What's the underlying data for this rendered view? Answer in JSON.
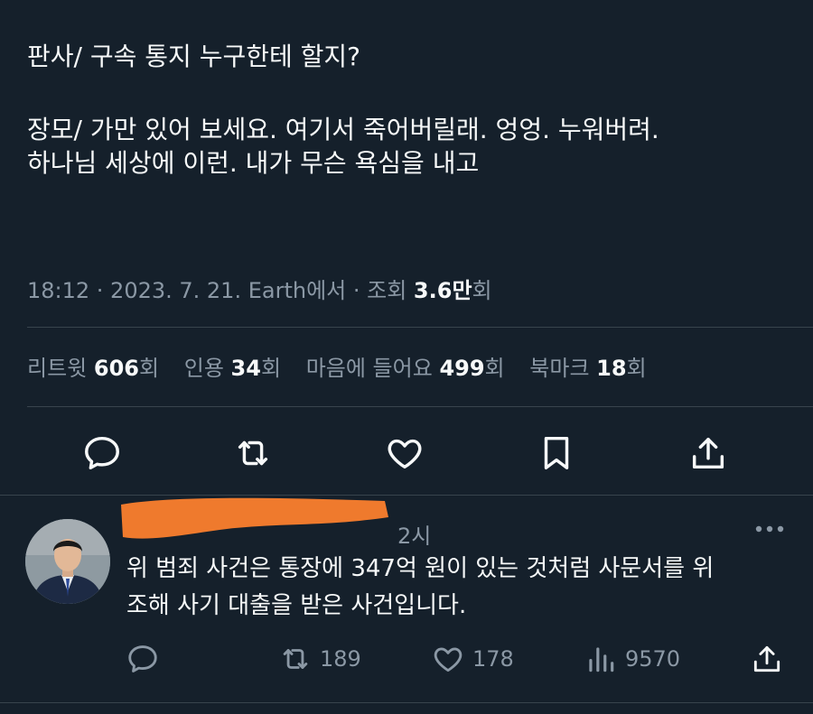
{
  "tweet": {
    "line1": "판사/ 구속 통지 누구한테 할지?",
    "line2": "장모/ 가만 있어 보세요. 여기서 죽어버릴래. 엉엉. 누워버려.",
    "line3": "하나님 세상에 이런. 내가 무슨 욕심을 내고",
    "time": "18:12 · 2023. 7. 21. Earth에서 · 조회",
    "views": "3.6만",
    "views_suffix": "회"
  },
  "stats": {
    "retweets_label": "리트윗",
    "retweets": "606",
    "quotes_label": "인용",
    "quotes": "34",
    "likes_label": "마음에 들어요",
    "likes": "499",
    "bookmarks_label": "북마크",
    "bookmarks": "18",
    "suffix": "회"
  },
  "actions": [
    "reply-icon",
    "retweet-icon",
    "heart-icon",
    "bookmark-icon",
    "share-icon"
  ],
  "reply": {
    "time": "2시",
    "text_line1": "위 범죄 사건은 통장에 347억 원이 있는 것처럼 사문서를 위",
    "text_line2": "조해 사기 대출을 받은 사건입니다.",
    "retweets": "189",
    "likes": "178",
    "views": "9570"
  },
  "colors": {
    "background": "#15202b",
    "text": "#f7f9f9",
    "muted": "#8b98a5",
    "divider": "#38444d",
    "redaction": "#ef7a2d"
  }
}
